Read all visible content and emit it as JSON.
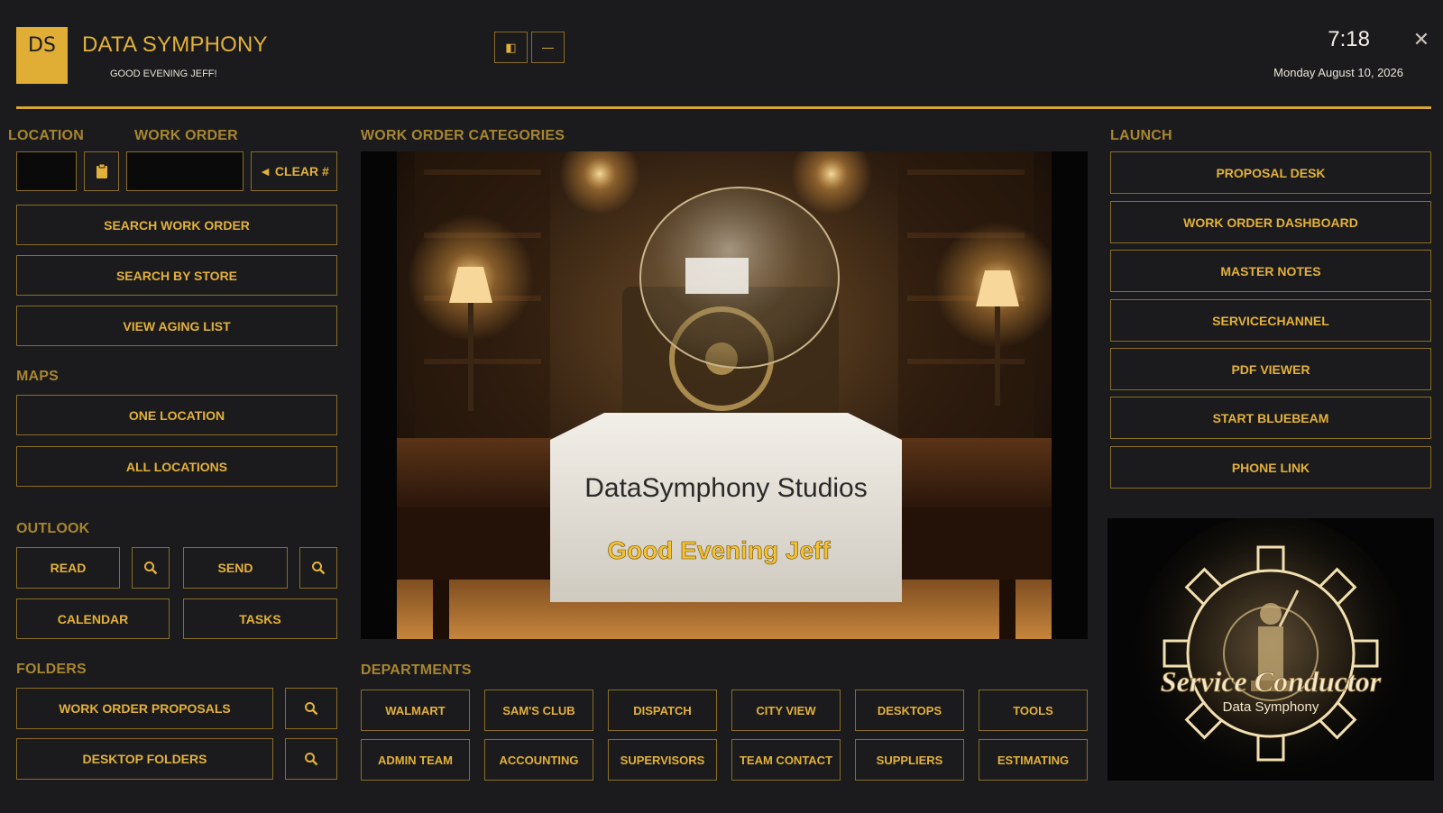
{
  "header": {
    "logo_text": "DS",
    "app_title": "DATA SYMPHONY",
    "greeting": "GOOD EVENING JEFF!",
    "clock": "7:18",
    "date": "Monday August 10, 2026",
    "close_glyph": "✕",
    "panel_glyph": "◧",
    "minimize_glyph": "—"
  },
  "left": {
    "location_label": "LOCATION",
    "work_order_label": "WORK ORDER",
    "clipboard_icon": "clipboard-icon",
    "clear_label": "◄ CLEAR #",
    "search_work_order": "SEARCH WORK ORDER",
    "search_by_store": "SEARCH BY STORE",
    "view_aging_list": "VIEW AGING LIST",
    "maps_label": "MAPS",
    "one_location": "ONE LOCATION",
    "all_locations": "ALL LOCATIONS",
    "outlook_label": "OUTLOOK",
    "read": "READ",
    "send": "SEND",
    "calendar": "CALENDAR",
    "tasks": "TASKS",
    "folders_label": "FOLDERS",
    "work_order_proposals": "WORK ORDER PROPOSALS",
    "desktop_folders": "DESKTOP FOLDERS"
  },
  "center": {
    "categories_label": "WORK ORDER CATEGORIES",
    "hero_studio_text": "DataSymphony Studios",
    "hero_greeting": "Good Evening Jeff",
    "departments_label": "DEPARTMENTS",
    "departments": [
      "WALMART",
      "SAM'S CLUB",
      "DISPATCH",
      "CITY VIEW",
      "DESKTOPS",
      "TOOLS",
      "ADMIN TEAM",
      "ACCOUNTING",
      "SUPERVISORS",
      "TEAM CONTACT",
      "SUPPLIERS",
      "ESTIMATING"
    ]
  },
  "right": {
    "launch_label": "LAUNCH",
    "launch_items": [
      "PROPOSAL DESK",
      "WORK ORDER DASHBOARD",
      "MASTER NOTES",
      "SERVICECHANNEL",
      "PDF VIEWER",
      "START BLUEBEAM",
      "PHONE LINK"
    ],
    "service_title": "Service Conductor",
    "service_sub": "Data Symphony"
  },
  "colors": {
    "background": "#1b1b1d",
    "accent": "#e3b13a",
    "border": "#8a6d26",
    "heading": "#a88630"
  }
}
